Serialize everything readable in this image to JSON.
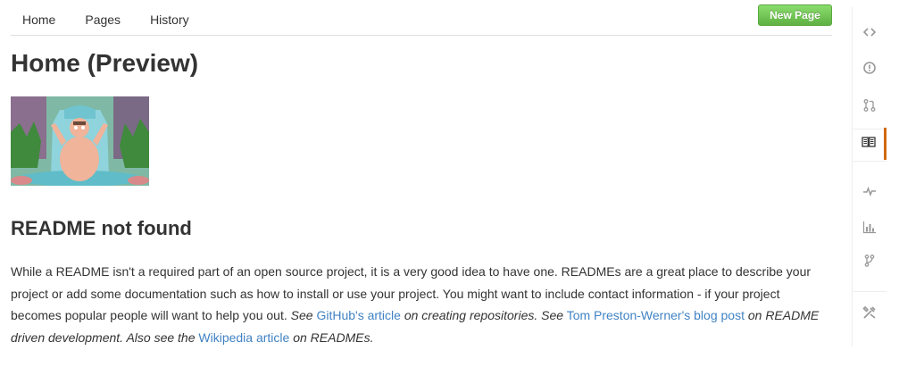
{
  "nav": {
    "links": [
      "Home",
      "Pages",
      "History"
    ],
    "new_page_label": "New Page"
  },
  "page": {
    "title": "Home (Preview)",
    "section_heading": "README not found"
  },
  "readme": {
    "p1": "While a README isn't a required part of an open source project, it is a very good idea to have one. READMEs are a great place to describe your project or add some documentation such as how to install or use your project. You might want to include contact information - if your project becomes popular people will want to help you out.",
    "see1": "See",
    "link1": "GitHub's article",
    "mid1": "on creating repositories. See",
    "link2": "Tom Preston-Werner's blog post",
    "mid2": "on README driven development. Also see the",
    "link3": "Wikipedia article",
    "end": "on READMEs."
  },
  "repo_nav": {
    "items": [
      "code-icon",
      "issues-icon",
      "pull-request-icon",
      "wiki-icon",
      "pulse-icon",
      "graphs-icon",
      "network-icon",
      "settings-icon"
    ],
    "selected": "wiki-icon",
    "accent_color": "#d26911"
  },
  "colors": {
    "link": "#4183c4",
    "button_green": "#60b044"
  }
}
